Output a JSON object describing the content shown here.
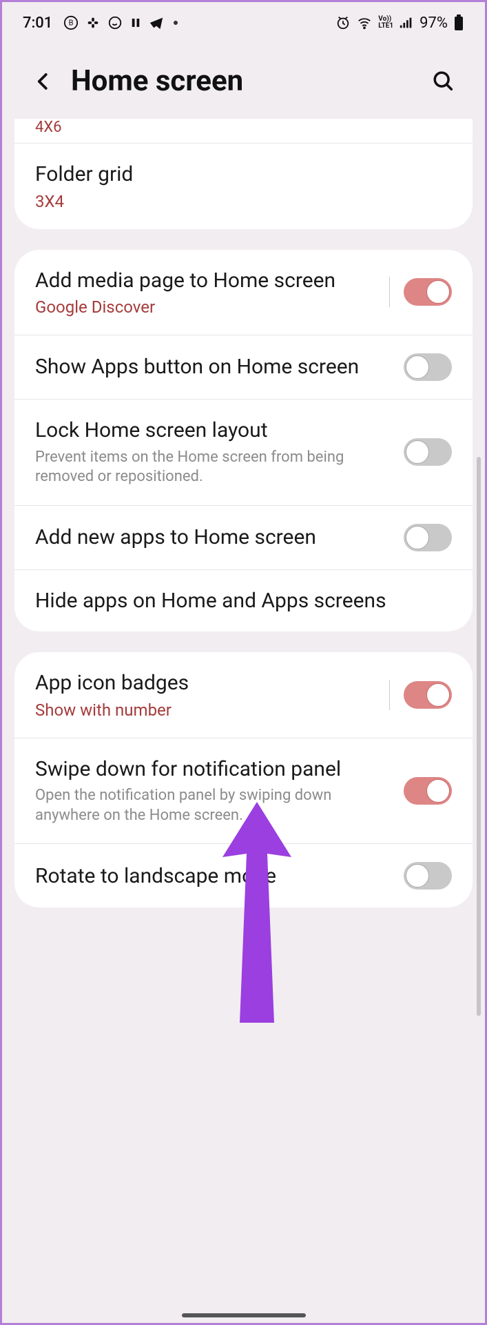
{
  "status": {
    "time": "7:01",
    "battery": "97%"
  },
  "header": {
    "title": "Home screen"
  },
  "card1": {
    "cut_value": "4X6",
    "folder_grid_title": "Folder grid",
    "folder_grid_value": "3X4"
  },
  "card2": {
    "media_title": "Add media page to Home screen",
    "media_sub": "Google Discover",
    "apps_btn_title": "Show Apps button on Home screen",
    "lock_title": "Lock Home screen layout",
    "lock_desc": "Prevent items on the Home screen from being removed or repositioned.",
    "addnew_title": "Add new apps to Home screen",
    "hide_title": "Hide apps on Home and Apps screens"
  },
  "card3": {
    "badges_title": "App icon badges",
    "badges_sub": "Show with number",
    "swipe_title": "Swipe down for notification panel",
    "swipe_desc": "Open the notification panel by swiping down anywhere on the Home screen.",
    "rotate_title": "Rotate to landscape mode"
  }
}
